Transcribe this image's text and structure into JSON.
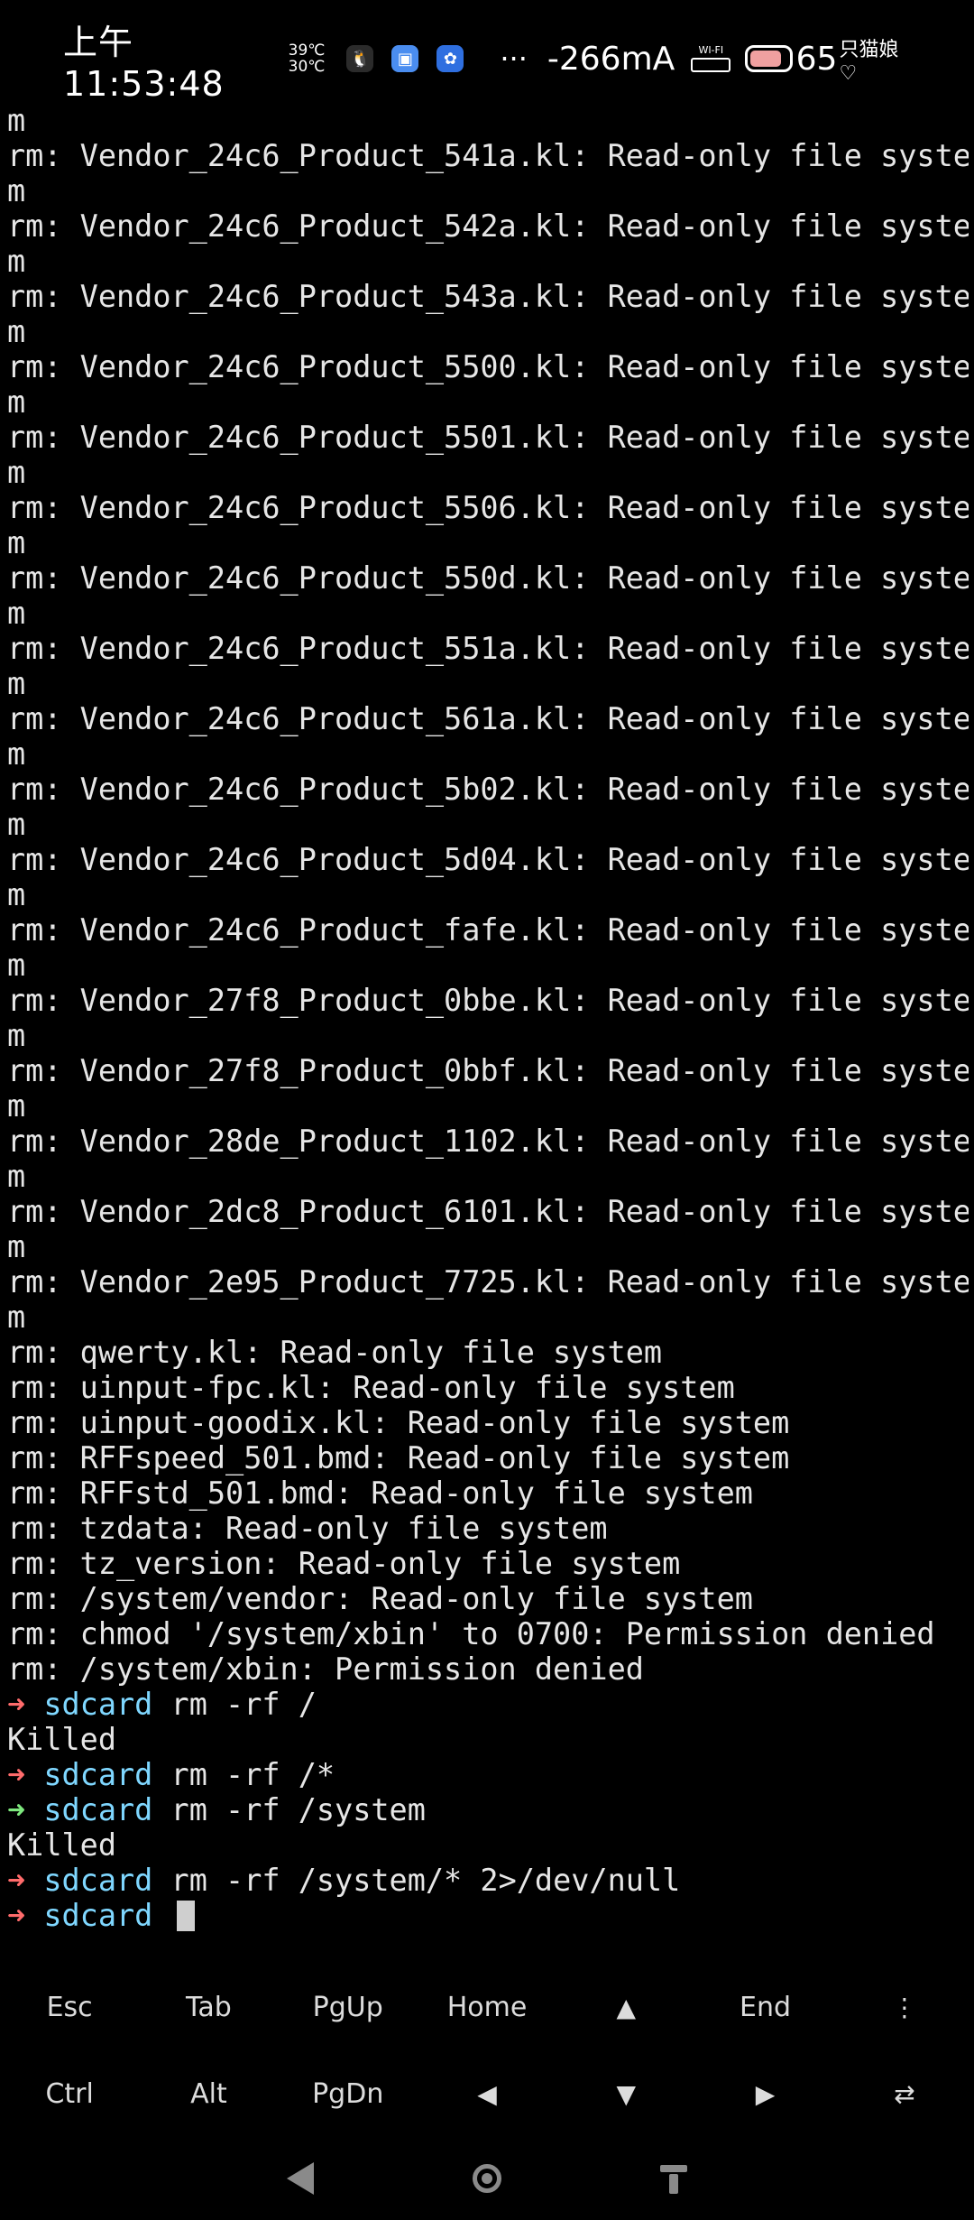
{
  "status_bar": {
    "time": "上午11:53:48",
    "temp_top": "39℃",
    "temp_bottom": "30℃",
    "more": "···",
    "current": "-266mA",
    "wifi_label": "WI-FI",
    "battery_level": "65",
    "carrier": "只猫娘♡"
  },
  "terminal": {
    "lines": [
      "m",
      "rm: Vendor_24c6_Product_541a.kl: Read-only file syste",
      "m",
      "rm: Vendor_24c6_Product_542a.kl: Read-only file syste",
      "m",
      "rm: Vendor_24c6_Product_543a.kl: Read-only file syste",
      "m",
      "rm: Vendor_24c6_Product_5500.kl: Read-only file syste",
      "m",
      "rm: Vendor_24c6_Product_5501.kl: Read-only file syste",
      "m",
      "rm: Vendor_24c6_Product_5506.kl: Read-only file syste",
      "m",
      "rm: Vendor_24c6_Product_550d.kl: Read-only file syste",
      "m",
      "rm: Vendor_24c6_Product_551a.kl: Read-only file syste",
      "m",
      "rm: Vendor_24c6_Product_561a.kl: Read-only file syste",
      "m",
      "rm: Vendor_24c6_Product_5b02.kl: Read-only file syste",
      "m",
      "rm: Vendor_24c6_Product_5d04.kl: Read-only file syste",
      "m",
      "rm: Vendor_24c6_Product_fafe.kl: Read-only file syste",
      "m",
      "rm: Vendor_27f8_Product_0bbe.kl: Read-only file syste",
      "m",
      "rm: Vendor_27f8_Product_0bbf.kl: Read-only file syste",
      "m",
      "rm: Vendor_28de_Product_1102.kl: Read-only file syste",
      "m",
      "rm: Vendor_2dc8_Product_6101.kl: Read-only file syste",
      "m",
      "rm: Vendor_2e95_Product_7725.kl: Read-only file syste",
      "m",
      "rm: qwerty.kl: Read-only file system",
      "rm: uinput-fpc.kl: Read-only file system",
      "rm: uinput-goodix.kl: Read-only file system",
      "rm: RFFspeed_501.bmd: Read-only file system",
      "rm: RFFstd_501.bmd: Read-only file system",
      "rm: tzdata: Read-only file system",
      "rm: tz_version: Read-only file system",
      "rm: /system/vendor: Read-only file system",
      "rm: chmod '/system/xbin' to 0700: Permission denied",
      "rm: /system/xbin: Permission denied"
    ],
    "prompt_arrow": "➜",
    "prompt_dir": "sdcard",
    "commands": [
      {
        "cmd": "rm -rf /",
        "output": "Killed"
      },
      {
        "cmd": "rm -rf /*"
      },
      {
        "cmd": "rm -rf /system",
        "output": "Killed"
      },
      {
        "cmd": "rm -rf /system/* 2>/dev/null"
      }
    ]
  },
  "extra_keys": {
    "row1": [
      "Esc",
      "Tab",
      "PgUp",
      "Home",
      "▲",
      "End",
      "⋮"
    ],
    "row2": [
      "Ctrl",
      "Alt",
      "PgDn",
      "◀",
      "▼",
      "▶",
      "⇄"
    ]
  }
}
